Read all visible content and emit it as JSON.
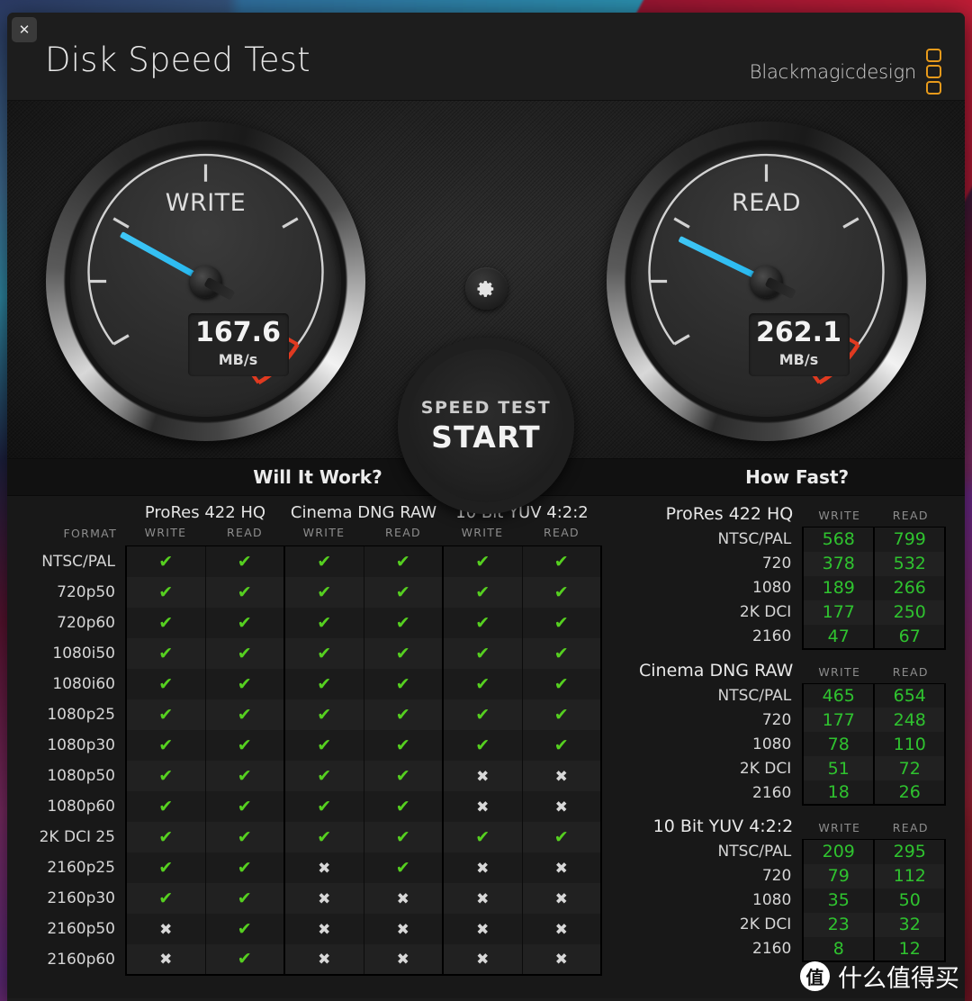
{
  "window": {
    "close_label": "✕",
    "title": "Disk Speed Test",
    "brand": "Blackmagicdesign"
  },
  "gauges": {
    "write": {
      "label": "WRITE",
      "value": "167.6",
      "unit": "MB/s",
      "needle_angle_deg": 209
    },
    "read": {
      "label": "READ",
      "value": "262.1",
      "unit": "MB/s",
      "needle_angle_deg": 206
    }
  },
  "controls": {
    "settings_icon": "gear-icon",
    "start_sub_label": "SPEED TEST",
    "start_main_label": "START"
  },
  "will_it_work": {
    "title": "Will It Work?",
    "format_header": "FORMAT",
    "codecs": [
      "ProRes 422 HQ",
      "Cinema DNG RAW",
      "10 Bit YUV 4:2:2"
    ],
    "sub_headers": [
      "WRITE",
      "READ"
    ],
    "ok_glyph": "✔",
    "no_glyph": "✖",
    "rows": [
      {
        "format": "NTSC/PAL",
        "cells": [
          true,
          true,
          true,
          true,
          true,
          true
        ]
      },
      {
        "format": "720p50",
        "cells": [
          true,
          true,
          true,
          true,
          true,
          true
        ]
      },
      {
        "format": "720p60",
        "cells": [
          true,
          true,
          true,
          true,
          true,
          true
        ]
      },
      {
        "format": "1080i50",
        "cells": [
          true,
          true,
          true,
          true,
          true,
          true
        ]
      },
      {
        "format": "1080i60",
        "cells": [
          true,
          true,
          true,
          true,
          true,
          true
        ]
      },
      {
        "format": "1080p25",
        "cells": [
          true,
          true,
          true,
          true,
          true,
          true
        ]
      },
      {
        "format": "1080p30",
        "cells": [
          true,
          true,
          true,
          true,
          true,
          true
        ]
      },
      {
        "format": "1080p50",
        "cells": [
          true,
          true,
          true,
          true,
          false,
          false
        ]
      },
      {
        "format": "1080p60",
        "cells": [
          true,
          true,
          true,
          true,
          false,
          false
        ]
      },
      {
        "format": "2K DCI 25",
        "cells": [
          true,
          true,
          true,
          true,
          true,
          true
        ]
      },
      {
        "format": "2160p25",
        "cells": [
          true,
          true,
          false,
          true,
          false,
          false
        ]
      },
      {
        "format": "2160p30",
        "cells": [
          true,
          true,
          false,
          false,
          false,
          false
        ]
      },
      {
        "format": "2160p50",
        "cells": [
          false,
          true,
          false,
          false,
          false,
          false
        ]
      },
      {
        "format": "2160p60",
        "cells": [
          false,
          true,
          false,
          false,
          false,
          false
        ]
      }
    ]
  },
  "how_fast": {
    "title": "How Fast?",
    "col_write": "WRITE",
    "col_read": "READ",
    "sections": [
      {
        "codec": "ProRes 422 HQ",
        "rows": [
          {
            "label": "NTSC/PAL",
            "write": "568",
            "read": "799"
          },
          {
            "label": "720",
            "write": "378",
            "read": "532"
          },
          {
            "label": "1080",
            "write": "189",
            "read": "266"
          },
          {
            "label": "2K DCI",
            "write": "177",
            "read": "250"
          },
          {
            "label": "2160",
            "write": "47",
            "read": "67"
          }
        ]
      },
      {
        "codec": "Cinema DNG RAW",
        "rows": [
          {
            "label": "NTSC/PAL",
            "write": "465",
            "read": "654"
          },
          {
            "label": "720",
            "write": "177",
            "read": "248"
          },
          {
            "label": "1080",
            "write": "78",
            "read": "110"
          },
          {
            "label": "2K DCI",
            "write": "51",
            "read": "72"
          },
          {
            "label": "2160",
            "write": "18",
            "read": "26"
          }
        ]
      },
      {
        "codec": "10 Bit YUV 4:2:2",
        "rows": [
          {
            "label": "NTSC/PAL",
            "write": "209",
            "read": "295"
          },
          {
            "label": "720",
            "write": "79",
            "read": "112"
          },
          {
            "label": "1080",
            "write": "35",
            "read": "50"
          },
          {
            "label": "2K DCI",
            "write": "23",
            "read": "32"
          },
          {
            "label": "2160",
            "write": "8",
            "read": "12"
          }
        ]
      }
    ]
  },
  "watermark": {
    "logo": "值",
    "text": "什么值得买"
  },
  "colors": {
    "accent_blue": "#3fc6f5",
    "ok_green": "#56d020",
    "value_green": "#2fc32f",
    "brand_orange": "#e79a1b",
    "redzone": "#e03a20"
  }
}
